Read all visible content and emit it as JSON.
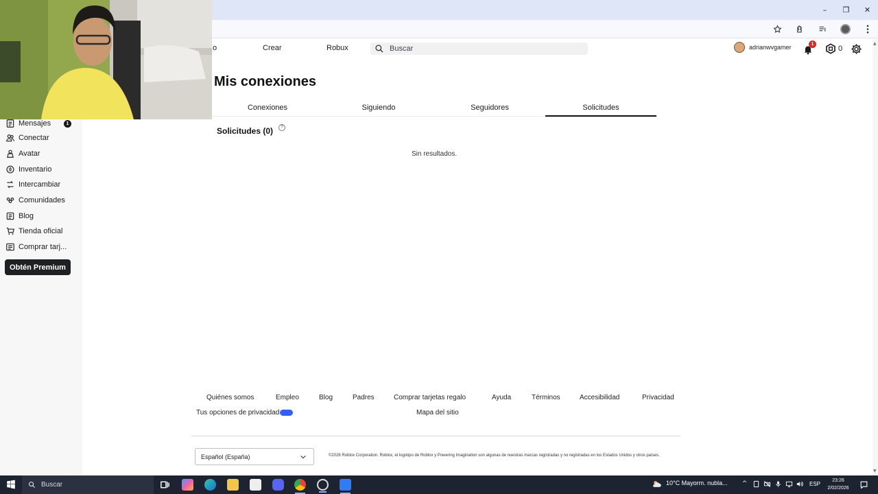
{
  "browser": {
    "window_buttons": [
      "–",
      "❐",
      "✕"
    ]
  },
  "topnav": {
    "partial_item": "o",
    "create": "Crear",
    "robux": "Robux",
    "search_placeholder": "Buscar",
    "username": "adrianwvgamer",
    "notifications_count": "1",
    "robux_balance": "0"
  },
  "sidebar": {
    "items": [
      {
        "label": "Mensajes",
        "icon": "messages-icon"
      },
      {
        "label": "Conectar",
        "icon": "connect-icon"
      },
      {
        "label": "Avatar",
        "icon": "avatar-icon"
      },
      {
        "label": "Inventario",
        "icon": "inventory-icon"
      },
      {
        "label": "Intercambiar",
        "icon": "trade-icon"
      },
      {
        "label": "Comunidades",
        "icon": "communities-icon"
      },
      {
        "label": "Blog",
        "icon": "blog-icon"
      },
      {
        "label": "Tienda oficial",
        "icon": "shop-icon"
      },
      {
        "label": "Comprar tarj...",
        "icon": "gift-card-icon"
      }
    ],
    "messages_badge": "1",
    "premium_button": "Obtén Premium"
  },
  "main": {
    "title": "Mis conexiones",
    "tabs": [
      {
        "label": "Conexiones",
        "active": false
      },
      {
        "label": "Siguiendo",
        "active": false
      },
      {
        "label": "Seguidores",
        "active": false
      },
      {
        "label": "Solicitudes",
        "active": true
      }
    ],
    "section_title": "Solicitudes (0)",
    "help_glyph": "?",
    "empty_message": "Sin resultados."
  },
  "footer": {
    "links": [
      "Quiénes somos",
      "Empleo",
      "Blog",
      "Padres",
      "Comprar tarjetas regalo",
      "Ayuda",
      "Términos",
      "Accesibilidad",
      "Privacidad"
    ],
    "privacy_options": "Tus opciones de privacidad",
    "sitemap": "Mapa del sitio",
    "language": "Español (España)",
    "copyright": "©2026 Roblox Corporation. Roblox, el logotipo de Roblox y Powering Imagination son algunas de nuestras marcas registradas y no registradas en los Estados Unidos y otros países."
  },
  "taskbar": {
    "search_placeholder": "Buscar",
    "weather": "10°C  Mayorm. nubla...",
    "language": "ESP",
    "time": "23:26",
    "date": "2/02/2026"
  },
  "colors": {
    "titlebar": "#dfe6f7",
    "sidebar": "#f7f7f8",
    "premium_button": "#1f2023",
    "notification_badge": "#e02424",
    "privacy_toggle": "#335fff",
    "taskbar": "#1d2330"
  }
}
